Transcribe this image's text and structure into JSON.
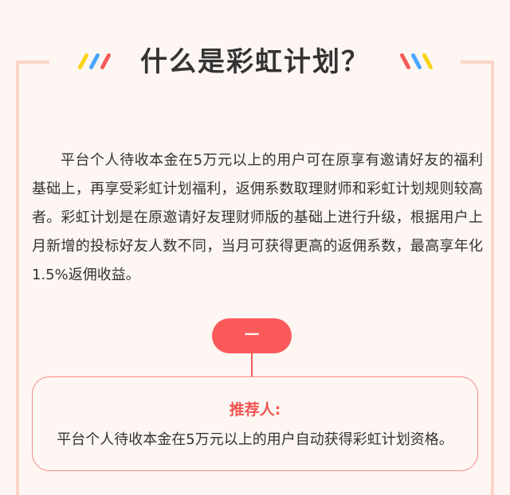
{
  "header": {
    "title": "什么是彩虹计划？"
  },
  "colors": {
    "accent": "#fb5a5a",
    "frame": "#fcd5c6",
    "background": "#fdf6f2",
    "stripes": [
      "#f8d416",
      "#4aa6ff",
      "#f45b5b"
    ]
  },
  "main": {
    "intro": "平台个人待收本金在5万元以上的用户可在原享有邀请好友的福利基础上，再享受彩虹计划福利，返佣系数取理财师和彩虹计划规则较高者。彩虹计划是在原邀请好友理财师版的基础上进行升级，根据用户上月新增的投标好友人数不同，当月可获得更高的返佣系数，最高享年化1.5%返佣收益。"
  },
  "step": {
    "label": "一"
  },
  "card": {
    "title": "推荐人:",
    "text": "平台个人待收本金在5万元以上的用户自动获得彩虹计划资格。"
  }
}
